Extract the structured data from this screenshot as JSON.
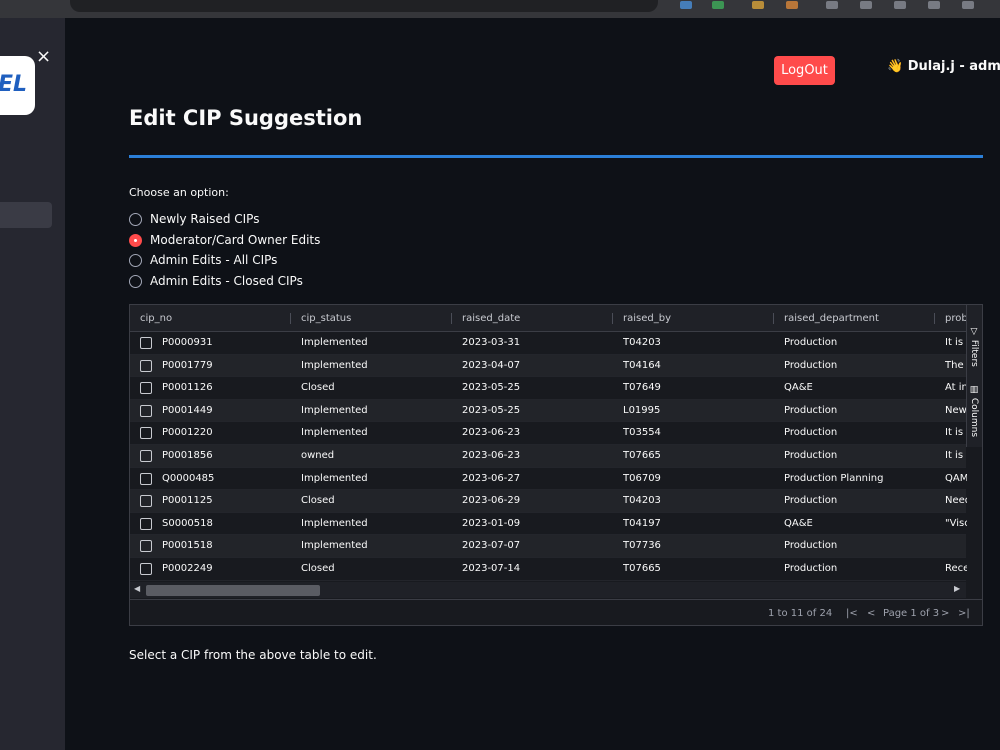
{
  "colors": {
    "background": "#0e1117",
    "sidebar": "#262730",
    "accent": "#ff4b4b",
    "divider": "#2b7fd8"
  },
  "sidebar": {
    "logo_text": "EL",
    "close_icon": "×"
  },
  "header": {
    "logout_label": "LogOut",
    "user_label": "👋 Dulaj.j - admin"
  },
  "page": {
    "title": "Edit CIP Suggestion",
    "choose_label": "Choose an option:",
    "options": [
      {
        "label": "Newly Raised CIPs",
        "selected": false
      },
      {
        "label": "Moderator/Card Owner Edits",
        "selected": true
      },
      {
        "label": "Admin Edits - All CIPs",
        "selected": false
      },
      {
        "label": "Admin Edits - Closed CIPs",
        "selected": false
      }
    ],
    "footer_text": "Select a CIP from the above table to edit."
  },
  "table": {
    "columns": [
      "cip_no",
      "cip_status",
      "raised_date",
      "raised_by",
      "raised_department",
      "prob"
    ],
    "rows": [
      [
        "P0000931",
        "Implemented",
        "2023-03-31",
        "T04203",
        "Production",
        "It is c"
      ],
      [
        "P0001779",
        "Implemented",
        "2023-04-07",
        "T04164",
        "Production",
        "The l"
      ],
      [
        "P0001126",
        "Closed",
        "2023-05-25",
        "T07649",
        "QA&E",
        "At in"
      ],
      [
        "P0001449",
        "Implemented",
        "2023-05-25",
        "L01995",
        "Production",
        "New"
      ],
      [
        "P0001220",
        "Implemented",
        "2023-06-23",
        "T03554",
        "Production",
        "It is w"
      ],
      [
        "P0001856",
        "owned",
        "2023-06-23",
        "T07665",
        "Production",
        "It is i"
      ],
      [
        "Q0000485",
        "Implemented",
        "2023-06-27",
        "T06709",
        "Production Planning",
        "QAM"
      ],
      [
        "P0001125",
        "Closed",
        "2023-06-29",
        "T04203",
        "Production",
        "Need"
      ],
      [
        "S0000518",
        "Implemented",
        "2023-01-09",
        "T04197",
        "QA&E",
        "\"Visc"
      ],
      [
        "P0001518",
        "Implemented",
        "2023-07-07",
        "T07736",
        "Production",
        ""
      ],
      [
        "P0002249",
        "Closed",
        "2023-07-14",
        "T07665",
        "Production",
        "Rece"
      ]
    ],
    "side_tabs": {
      "filters": "Filters",
      "columns": "Columns"
    },
    "pager": {
      "range": "1 to 11 of 24",
      "page": "Page 1 of 3"
    }
  }
}
